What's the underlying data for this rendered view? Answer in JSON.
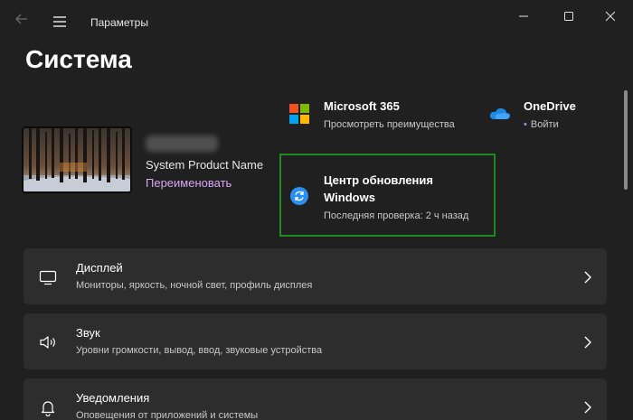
{
  "window": {
    "title": "Параметры",
    "page_title": "Система"
  },
  "device": {
    "model": "System Product Name",
    "rename_link": "Переименовать"
  },
  "tiles": {
    "ms365": {
      "title": "Microsoft 365",
      "subtitle": "Просмотреть преимущества"
    },
    "onedrive": {
      "title": "OneDrive",
      "subtitle": "Войти",
      "status_dot_color": "#c67ef5"
    },
    "update": {
      "title_line1": "Центр обновления",
      "title_line2": "Windows",
      "subtitle": "Последняя проверка: 2 ч назад",
      "highlight_color": "#1f8a1f"
    }
  },
  "settings": [
    {
      "icon": "monitor-icon",
      "title": "Дисплей",
      "subtitle": "Мониторы, яркость, ночной свет, профиль дисплея"
    },
    {
      "icon": "speaker-icon",
      "title": "Звук",
      "subtitle": "Уровни громкости, вывод, ввод, звуковые устройства"
    },
    {
      "icon": "bell-icon",
      "title": "Уведомления",
      "subtitle": "Оповещения от приложений и системы"
    }
  ],
  "colors": {
    "background": "#202020",
    "card": "#2d2d2d",
    "accent_link": "#d8a6f5",
    "update_icon": "#2a8ff0"
  }
}
